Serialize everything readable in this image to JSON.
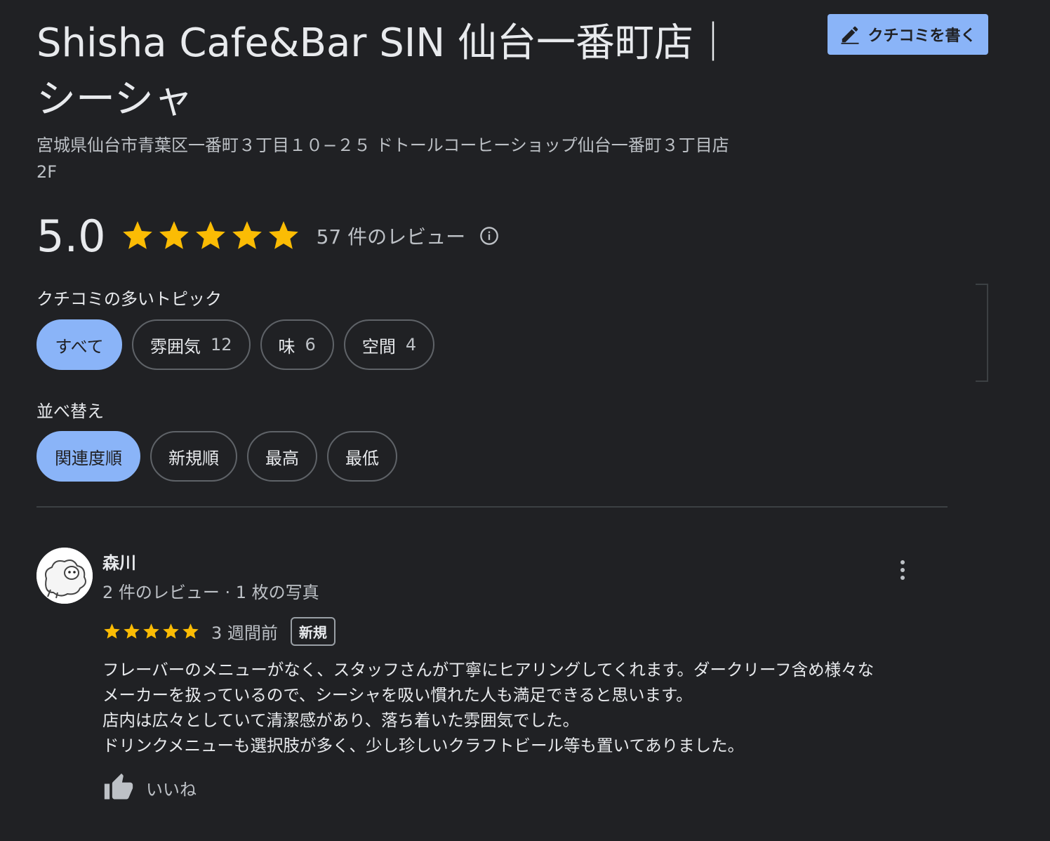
{
  "place": {
    "title": "Shisha Cafe&Bar SIN 仙台一番町店｜シーシャ",
    "address": "宮城県仙台市青葉区一番町３丁目１０−２５ ドトールコーヒーショップ仙台一番町３丁目店 2F"
  },
  "write_review": {
    "label": "クチコミを書く",
    "icon": "pencil-icon"
  },
  "rating": {
    "score": "5.0",
    "stars": 5,
    "review_count_label": "57 件のレビュー",
    "info_icon": "info-icon"
  },
  "topics": {
    "label": "クチコミの多いトピック",
    "chips": [
      {
        "label": "すべて",
        "count": "",
        "active": true
      },
      {
        "label": "雰囲気",
        "count": "12",
        "active": false
      },
      {
        "label": "味",
        "count": "6",
        "active": false
      },
      {
        "label": "空間",
        "count": "4",
        "active": false
      }
    ]
  },
  "sort": {
    "label": "並べ替え",
    "chips": [
      {
        "label": "関連度順",
        "active": true
      },
      {
        "label": "新規順",
        "active": false
      },
      {
        "label": "最高",
        "active": false
      },
      {
        "label": "最低",
        "active": false
      }
    ]
  },
  "review": {
    "reviewer_name": "森川",
    "reviewer_meta": "2 件のレビュー · 1 枚の写真",
    "stars": 5,
    "time_ago": "3 週間前",
    "badge": "新規",
    "text_lines": [
      "フレーバーのメニューがなく、スタッフさんが丁寧にヒアリングしてくれます。ダークリーフ含め様々な",
      "メーカーを扱っているので、シーシャを吸い慣れた人も満足できると思います。",
      "店内は広々としていて清潔感があり、落ち着いた雰囲気でした。",
      "ドリンクメニューも選択肢が多く、少し珍しいクラフトビール等も置いてありました。"
    ],
    "like_label": "いいね"
  },
  "colors": {
    "background": "#202124",
    "accent": "#8ab4f8",
    "star": "#fbbc04"
  }
}
